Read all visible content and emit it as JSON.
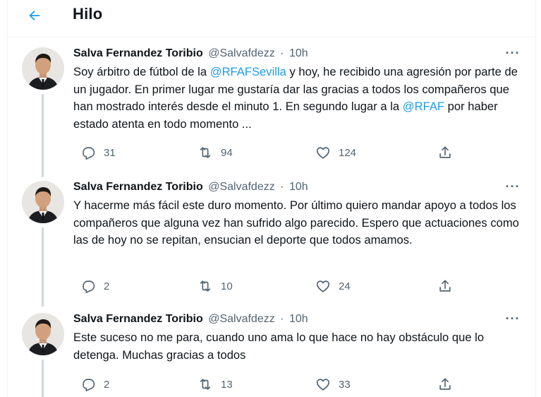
{
  "header": {
    "title": "Hilo"
  },
  "colors": {
    "accent": "#1d9bf0",
    "secondary_text": "#536471",
    "thread_line": "#cfd9de"
  },
  "tweets": [
    {
      "name": "Salva Fernandez Toribio",
      "handle": "@Salvafdezz",
      "sep": "·",
      "time": "10h",
      "more": "···",
      "text_parts": [
        "Soy árbitro de fútbol de la ",
        "@RFAFSevilla",
        " y hoy, he recibido una agresión por parte de un jugador. En primer lugar me gustaría dar las gracias a todos los compañeros que han mostrado interés desde el minuto 1. En segundo lugar a la ",
        "@RFAF",
        " por haber estado atenta en todo momento ..."
      ],
      "replies": "31",
      "retweets": "94",
      "likes": "124"
    },
    {
      "name": "Salva Fernandez Toribio",
      "handle": "@Salvafdezz",
      "sep": "·",
      "time": "10h",
      "more": "···",
      "text": "Y hacerme más fácil este duro momento. Por último quiero mandar apoyo a todos los compañeros que alguna vez han sufrido algo parecido. Espero que actuaciones como las de hoy no se repitan, ensucian el deporte que todos amamos.",
      "replies": "2",
      "retweets": "10",
      "likes": "24"
    },
    {
      "name": "Salva Fernandez Toribio",
      "handle": "@Salvafdezz",
      "sep": "·",
      "time": "10h",
      "more": "···",
      "text": "Este suceso no me para, cuando uno ama lo que hace no hay obstáculo que lo detenga. Muchas gracias a todos",
      "replies": "2",
      "retweets": "13",
      "likes": "33"
    }
  ],
  "icons": {
    "back": "arrow-left-icon",
    "reply": "reply-icon",
    "retweet": "retweet-icon",
    "like": "heart-icon",
    "share": "share-icon",
    "more": "more-icon"
  }
}
